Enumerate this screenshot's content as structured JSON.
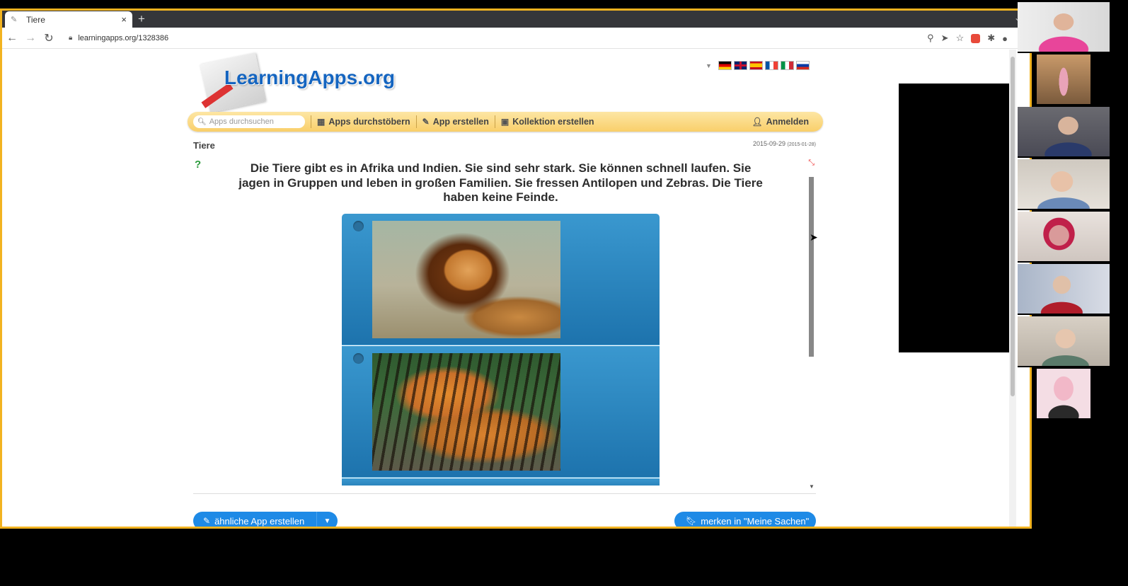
{
  "browser": {
    "tab_title": "Tiere",
    "tab_close": "×",
    "new_tab": "+",
    "url": "learningapps.org/1328386"
  },
  "site": {
    "logo_text": "LearningApps.org",
    "languages": [
      "de",
      "en",
      "es",
      "fr",
      "it",
      "ru"
    ],
    "nav": {
      "search_placeholder": "Apps durchsuchen",
      "browse": "Apps durchstöbern",
      "create_app": "App erstellen",
      "create_collection": "Kollektion erstellen",
      "login": "Anmelden"
    }
  },
  "app": {
    "title": "Tiere",
    "date": "2015-09-29",
    "date_small": "(2015-01-28)",
    "question": "Die Tiere gibt es in Afrika und Indien. Sie sind sehr stark. Sie können schnell laufen. Sie jagen in Gruppen und leben in großen Familien. Sie fressen Antilopen und Zebras. Die Tiere haben keine Feinde.",
    "options": [
      {
        "image": "lion photo"
      },
      {
        "image": "tiger photo"
      }
    ]
  },
  "buttons": {
    "similar_app": "ähnliche App erstellen",
    "bookmark": "merken in \"Meine Sachen\""
  },
  "colors": {
    "frame_border": "#f2b320",
    "nav_bar": "#f9cf6a",
    "card_blue": "#1d73ad",
    "button_blue": "#1e8ae6",
    "logo_blue": "#1565c0"
  }
}
